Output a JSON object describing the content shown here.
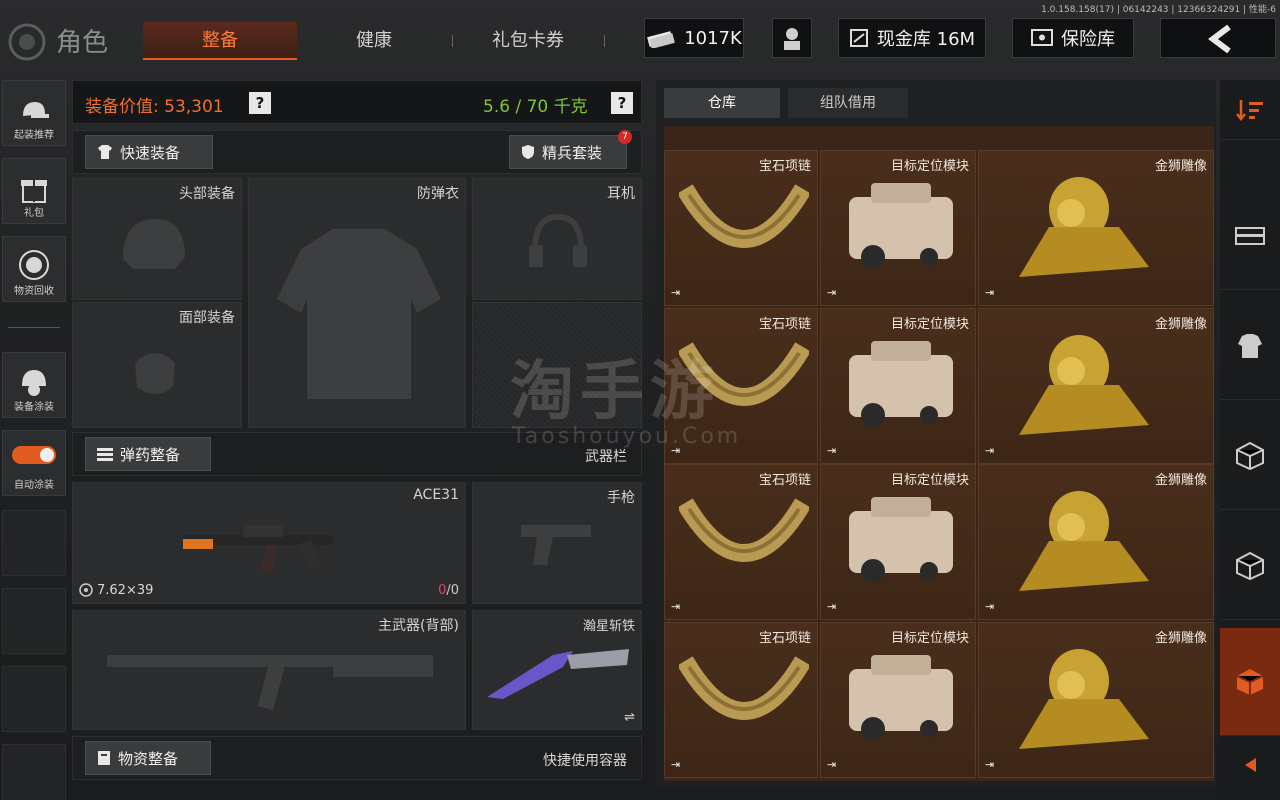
{
  "version_text": "1.0.158.158(17) | 06142243 | 12366324291 | 性能-6",
  "header": {
    "title": "角色",
    "tabs": [
      {
        "label": "整备",
        "active": true
      },
      {
        "label": "健康",
        "active": false
      },
      {
        "label": "礼包卡券",
        "active": false
      }
    ],
    "currency": "1017K",
    "cash_vault": "现金库 16M",
    "safe_box": "保险库"
  },
  "left_rail": [
    {
      "label": "起装推荐",
      "icon": "helmet-gun-icon"
    },
    {
      "label": "礼包",
      "icon": "gift-icon"
    },
    {
      "label": "物资回收",
      "icon": "recycle-icon"
    },
    {
      "label": "装备涂装",
      "icon": "helmet-paint-icon"
    },
    {
      "label": "自动涂装",
      "icon": "toggle-icon"
    }
  ],
  "equipment": {
    "value_label": "装备价值: 53,301",
    "weight_label": "5.6 / 70 千克",
    "quick_equip": "快速装备",
    "elite_set": "精兵套装",
    "elite_badge": "7",
    "slots": {
      "head": "头部装备",
      "armor": "防弹衣",
      "earphone": "耳机",
      "face": "面部装备"
    },
    "ammo_button": "弹药整备",
    "weapon_bar_label": "武器栏",
    "primary_weapon_name": "ACE31",
    "primary_ammo": "7.62×39",
    "primary_mag_current": "0",
    "primary_mag_total": "/0",
    "pistol": "手枪",
    "back_weapon": "主武器(背部)",
    "melee": "瀚星斩铁",
    "supplies_button": "物资整备",
    "quick_container": "快捷使用容器"
  },
  "warehouse": {
    "tabs": [
      {
        "label": "仓库",
        "active": true
      },
      {
        "label": "组队借用",
        "active": false
      }
    ],
    "rows": [
      [
        "宝石项链",
        "目标定位模块",
        "金狮雕像"
      ],
      [
        "宝石项链",
        "目标定位模块",
        "金狮雕像"
      ],
      [
        "宝石项链",
        "目标定位模块",
        "金狮雕像"
      ],
      [
        "宝石项链",
        "目标定位模块",
        "金狮雕像"
      ]
    ]
  },
  "right_rail": [
    "sort-icon",
    "container-icon",
    "vest-icon",
    "box-icon",
    "box-icon",
    "box-active-icon",
    "arrow-left-icon"
  ],
  "watermark": {
    "main": "淘手游",
    "sub": "Taoshouyou.Com"
  },
  "colors": {
    "accent": "#e25b21",
    "green_weight": "#7ec53a",
    "value_orange": "#f07030"
  }
}
